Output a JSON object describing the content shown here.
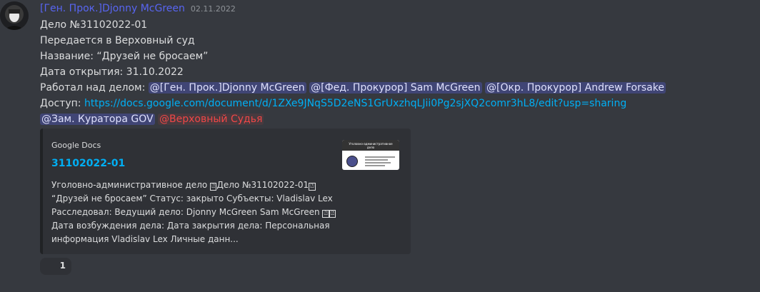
{
  "message": {
    "username": "[Ген. Прок.]Djonny McGreen",
    "timestamp": "02.11.2022",
    "colors": {
      "username": "#5865f2",
      "link": "#00aff4",
      "mention_red": "#f04747",
      "background": "#36393f",
      "embed_bg": "#2f3136"
    },
    "lines": {
      "case": "Дело №31102022-01",
      "transfer": "Передается в Верховный суд",
      "name": "Название: “Друзей не бросаем”",
      "opened": "Дата открытия: 31.10.2022",
      "worked_prefix": "Работал над делом:",
      "mentions": [
        "@[Ген. Прок.]Djonny McGreen",
        "@[Фед. Прокурор] Sam McGreen",
        "@[Окр. Прокурор] Andrew Forsake"
      ],
      "access_label": "Доступ:",
      "access_url": "https://docs.google.com/document/d/1ZXe9JNqS5D2eNS1GrUxzhqLJii0Pg2sjXQ2comr3hL8/edit?usp=sharing",
      "role_mentions": [
        "@Зам. Куратора GOV",
        "@Верховный Судья"
      ]
    },
    "embed": {
      "provider": "Google Docs",
      "title": "31102022-01",
      "desc_1a": "Уголовно-административное дело ",
      "desc_1b": "Дело №31102022-01",
      "desc_2": "“Друзей не бросаем” Статус: закрыто Субъекты: Vladislav Lex",
      "desc_3": "Расследовал: Ведущий дело: Djonny McGreen Sam McGreen ",
      "desc_4": "Дата возбуждения дела: Дата закрытия дела: Персональная",
      "desc_5": "информация Vladislav Lex Личные данн...",
      "box_char": "⍰",
      "thumbnail_title": "Уголовно-административное дело"
    },
    "reaction": {
      "count": "1"
    }
  }
}
